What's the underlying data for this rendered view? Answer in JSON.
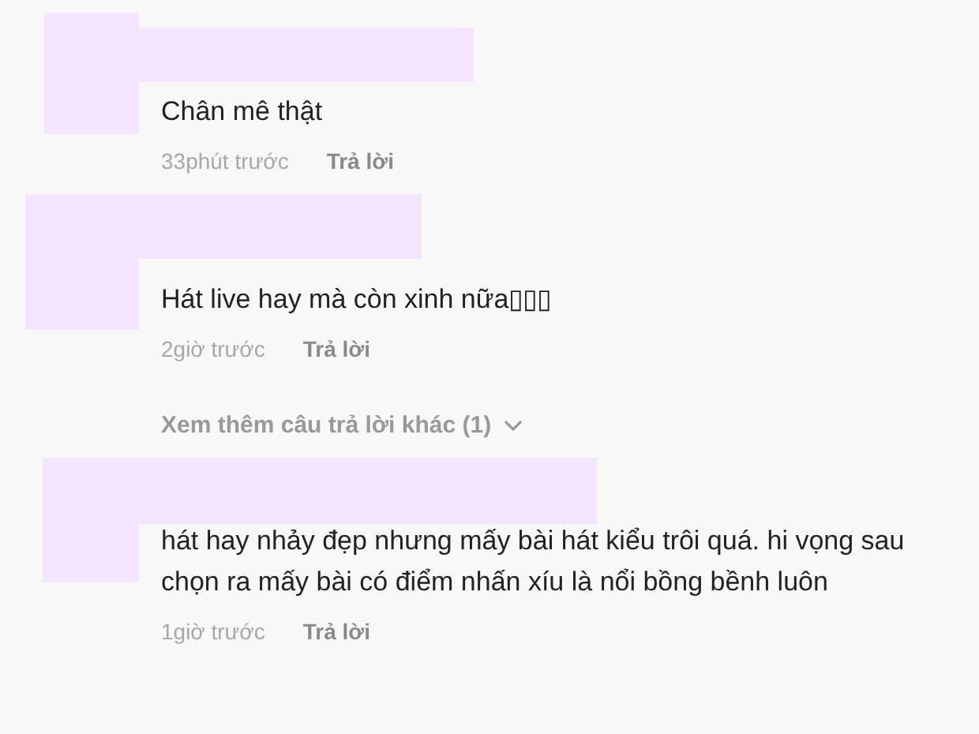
{
  "comments": [
    {
      "text": "Chân mê thật",
      "time": "33phút trước",
      "reply": "Trả lời"
    },
    {
      "text": "Hát live hay mà còn xinh nữa▯▯▯",
      "time": "2giờ trước",
      "reply": "Trả lời",
      "more_replies": "Xem thêm câu trả lời khác (1)"
    },
    {
      "text": "hát hay nhảy đẹp nhưng mấy bài hát kiểu trôi quá. hi vọng sau chọn ra mấy bài có điểm nhấn xíu là nổi bồng bềnh luôn",
      "time": "1giờ trước",
      "reply": "Trả lời"
    }
  ]
}
